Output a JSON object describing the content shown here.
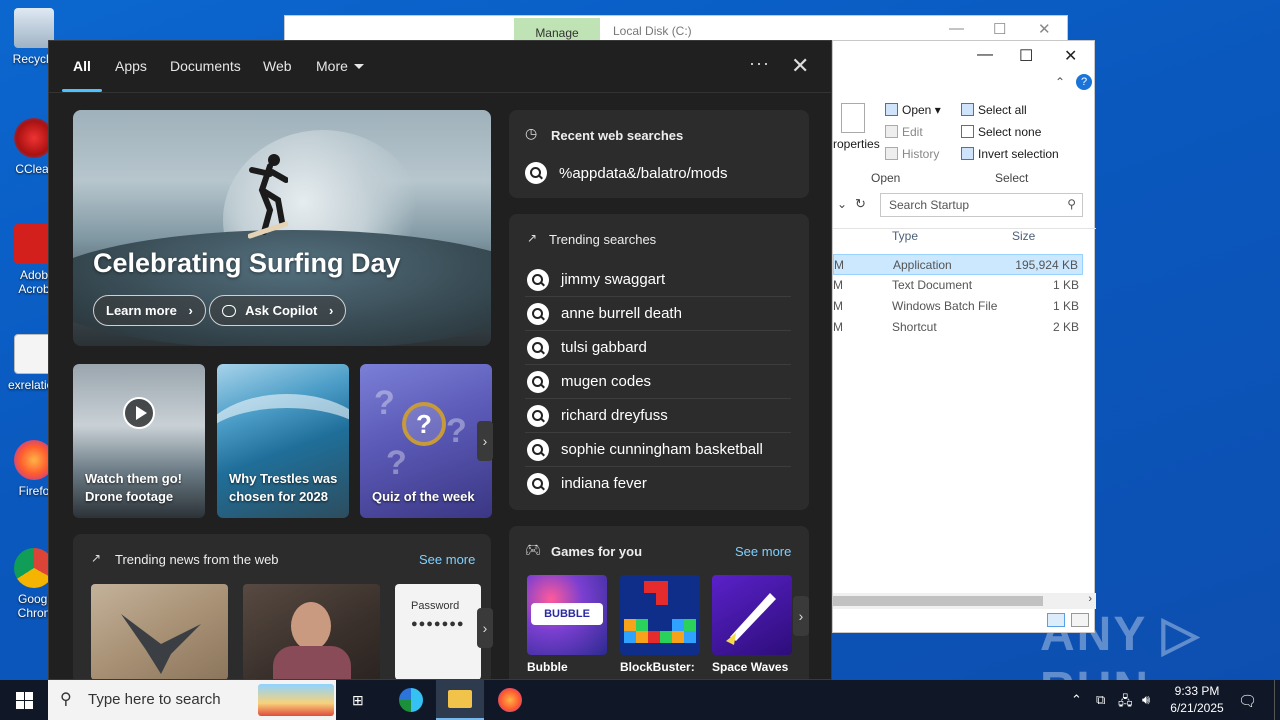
{
  "desktop": {
    "icons": [
      {
        "label": "Recycle"
      },
      {
        "label": "CClear"
      },
      {
        "label": "Adob Acrob"
      },
      {
        "label": "exrelation"
      },
      {
        "label": "Firefo"
      },
      {
        "label": "Googl Chron"
      }
    ],
    "watermark": "ANY ▷ RUN"
  },
  "explorer_back": {
    "manage": "Manage",
    "title": "Local Disk (C:)"
  },
  "explorer": {
    "ribbon": {
      "properties": "roperties",
      "open": "Open",
      "edit": "Edit",
      "history": "History",
      "open_group": "Open",
      "select_all": "Select all",
      "select_none": "Select none",
      "invert_selection": "Invert selection",
      "select_group": "Select"
    },
    "search_placeholder": "Search Startup",
    "columns": {
      "type": "Type",
      "size": "Size"
    },
    "rows": [
      {
        "time": "M",
        "type": "Application",
        "size": "195,924 KB"
      },
      {
        "time": "M",
        "type": "Text Document",
        "size": "1 KB"
      },
      {
        "time": "M",
        "type": "Windows Batch File",
        "size": "1 KB"
      },
      {
        "time": "M",
        "type": "Shortcut",
        "size": "2 KB"
      }
    ]
  },
  "search_panel": {
    "tabs": [
      "All",
      "Apps",
      "Documents",
      "Web",
      "More"
    ],
    "hero": {
      "title": "Celebrating Surfing Day",
      "learn_more": "Learn more",
      "ask_copilot": "Ask Copilot"
    },
    "cards": [
      {
        "caption": "Watch them go! Drone footage"
      },
      {
        "caption": "Why Trestles was chosen for 2028"
      },
      {
        "caption": "Quiz of the week"
      }
    ],
    "news": {
      "title": "Trending news from the web",
      "see_more": "See more",
      "password_label": "Password"
    },
    "recent": {
      "title": "Recent web searches",
      "items": [
        "%appdata&/balatro/mods"
      ]
    },
    "trending": {
      "title": "Trending searches",
      "items": [
        "jimmy swaggart",
        "anne burrell death",
        "tulsi gabbard",
        "mugen codes",
        "richard dreyfuss",
        "sophie cunningham basketball",
        "indiana fever"
      ]
    },
    "games": {
      "title": "Games for you",
      "see_more": "See more",
      "items": [
        {
          "name": "Bubble"
        },
        {
          "name": "BlockBuster:"
        },
        {
          "name": "Space Waves"
        }
      ]
    }
  },
  "taskbar": {
    "search_placeholder": "Type here to search",
    "time": "9:33 PM",
    "date": "6/21/2025"
  }
}
